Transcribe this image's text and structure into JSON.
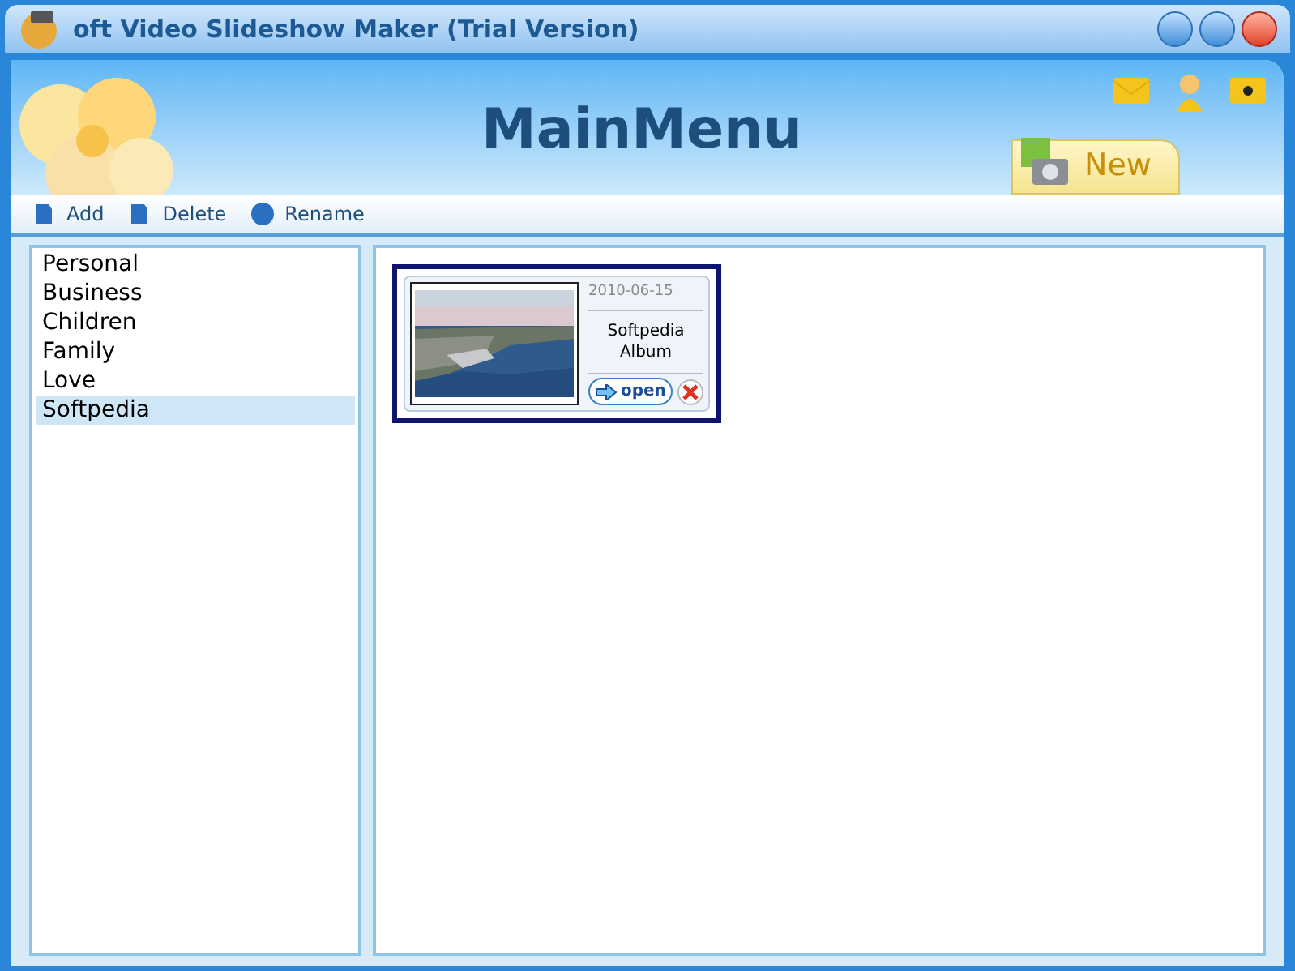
{
  "window": {
    "title": "oft Video Slideshow Maker (Trial Version)"
  },
  "header": {
    "title": "MainMenu",
    "new_tab": "New"
  },
  "toolbar": [
    "Add",
    "Delete",
    "Rename"
  ],
  "categories": [
    {
      "label": "Personal",
      "selected": false
    },
    {
      "label": "Business",
      "selected": false
    },
    {
      "label": "Children",
      "selected": false
    },
    {
      "label": "Family",
      "selected": false
    },
    {
      "label": "Love",
      "selected": false
    },
    {
      "label": "Softpedia",
      "selected": true
    }
  ],
  "albums": [
    {
      "date": "2010-06-15",
      "name": "Softpedia Album",
      "open": "open",
      "selected": true
    }
  ]
}
